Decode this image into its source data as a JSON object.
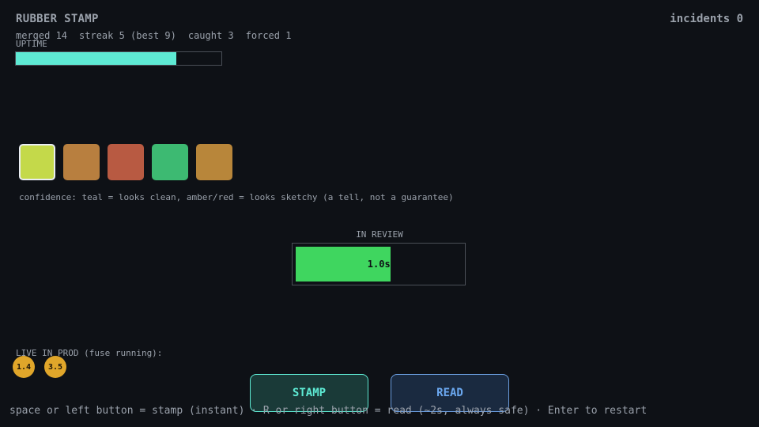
{
  "header": {
    "title": "RUBBER STAMP",
    "incidents": "incidents 0"
  },
  "stats": {
    "merged": "merged 14",
    "streak": "streak 5 (best 9)",
    "caught": "caught 3",
    "forced": "forced 1"
  },
  "uptime": {
    "label": "UPTIME",
    "fraction": 0.78,
    "color": "#5eead4"
  },
  "queue": {
    "tiles": [
      {
        "color": "#c4d94a",
        "active": true
      },
      {
        "color": "#b87f3f",
        "active": false
      },
      {
        "color": "#b85a42",
        "active": false
      },
      {
        "color": "#3dba72",
        "active": false
      },
      {
        "color": "#b8863a",
        "active": false
      }
    ],
    "hint": "confidence: teal = looks clean, amber/red = looks sketchy (a tell, not a guarantee)"
  },
  "review": {
    "label": "IN REVIEW",
    "time": "1.0s",
    "fraction": 0.57,
    "color": "#3fd65f"
  },
  "live": {
    "label": "LIVE IN PROD (fuse running):",
    "fuses": [
      "1.4",
      "3.5"
    ]
  },
  "buttons": {
    "stamp": "STAMP",
    "read": "READ"
  },
  "footer": "space or left button = stamp (instant) · R or right button = read (~2s, always safe) · Enter to restart"
}
